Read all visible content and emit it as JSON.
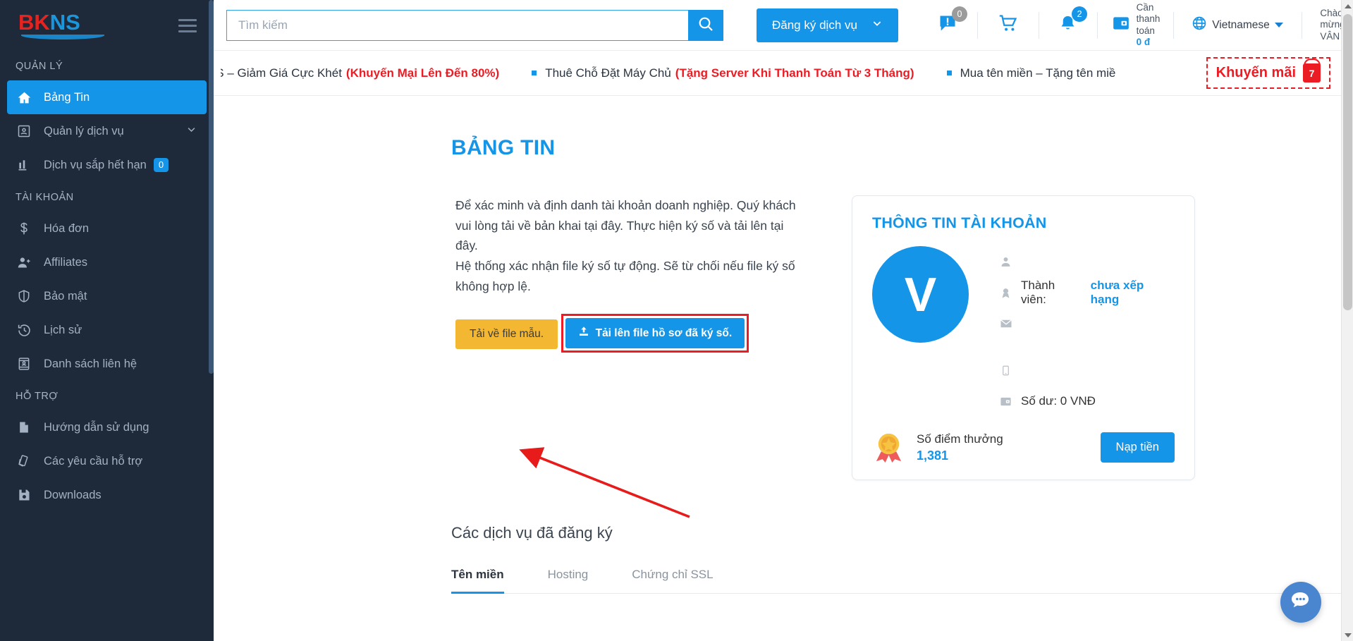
{
  "brand": {
    "part1": "BK",
    "part2": "NS"
  },
  "sidebar": {
    "sections": [
      {
        "label": "QUẢN LÝ",
        "items": [
          {
            "label": "Bảng Tin",
            "icon": "home-icon",
            "active": true
          },
          {
            "label": "Quản lý dịch vụ",
            "icon": "id-card-icon",
            "chevron": true
          },
          {
            "label": "Dịch vụ sắp hết hạn",
            "icon": "bar-chart-icon",
            "badge": "0"
          }
        ]
      },
      {
        "label": "TÀI KHOẢN",
        "items": [
          {
            "label": "Hóa đơn",
            "icon": "dollar-icon"
          },
          {
            "label": "Affiliates",
            "icon": "user-plus-icon"
          },
          {
            "label": "Bảo mật",
            "icon": "shield-icon"
          },
          {
            "label": "Lịch sử",
            "icon": "history-icon"
          },
          {
            "label": "Danh sách liên hệ",
            "icon": "contact-card-icon"
          }
        ]
      },
      {
        "label": "HỖ TRỢ",
        "items": [
          {
            "label": "Hướng dẫn sử dụng",
            "icon": "document-icon"
          },
          {
            "label": "Các yêu cầu hỗ trợ",
            "icon": "tickets-icon"
          },
          {
            "label": "Downloads",
            "icon": "save-disk-icon"
          }
        ]
      }
    ]
  },
  "topbar": {
    "search_placeholder": "Tìm kiếm",
    "search_value": "",
    "register_button": "Đăng ký dịch vụ",
    "support_count": "0",
    "notification_count": "2",
    "payment_label": "Cần thanh toán",
    "payment_amount": "0 đ",
    "language": "Vietnamese",
    "greeting": "Chào mừng",
    "username": "VÂN"
  },
  "promo": {
    "items": [
      {
        "text": "ud VPS – Giảm Giá Cực Khét",
        "highlight": "(Khuyến Mại Lên Đến 80%)"
      },
      {
        "text": "Thuê Chỗ Đặt Máy Chủ",
        "highlight": "(Tặng Server Khi Thanh Toán Từ 3 Tháng)"
      },
      {
        "text": "Mua tên miền – Tặng tên miề",
        "highlight": ""
      }
    ],
    "cta_label": "Khuyến mãi",
    "cta_badge": "7"
  },
  "page": {
    "title": "BẢNG TIN",
    "intro_line1": "Để xác minh và định danh tài khoản doanh nghiệp. Quý khách vui lòng tải về bản khai tại đây. Thực hiện ký số và tải lên tại đây.",
    "intro_line2": "Hệ thống xác nhận file ký số tự động. Sẽ từ chối nếu file ký số không hợp lệ.",
    "download_sample_button": "Tải về file mẫu.",
    "upload_button": "Tải lên file hồ sơ đã ký số."
  },
  "account_card": {
    "title": "THÔNG TIN TÀI KHOẢN",
    "avatar_letter": "V",
    "name": "",
    "member_label": "Thành viên:",
    "member_rank": "chưa xếp hạng",
    "email": "",
    "phone": "",
    "balance": "Số dư: 0 VNĐ",
    "points_label": "Số điểm thưởng",
    "points_value": "1,381",
    "topup_button": "Nạp tiền"
  },
  "services": {
    "heading": "Các dịch vụ đã đăng ký",
    "tabs": [
      {
        "label": "Tên miền",
        "active": true
      },
      {
        "label": "Hosting",
        "active": false
      },
      {
        "label": "Chứng chỉ SSL",
        "active": false
      }
    ]
  },
  "colors": {
    "brand_blue": "#1595e8",
    "brand_red": "#e8231f",
    "sidebar_bg": "#1e2a3a",
    "yellow": "#f4b731",
    "annotation_red": "#ed1c24"
  }
}
